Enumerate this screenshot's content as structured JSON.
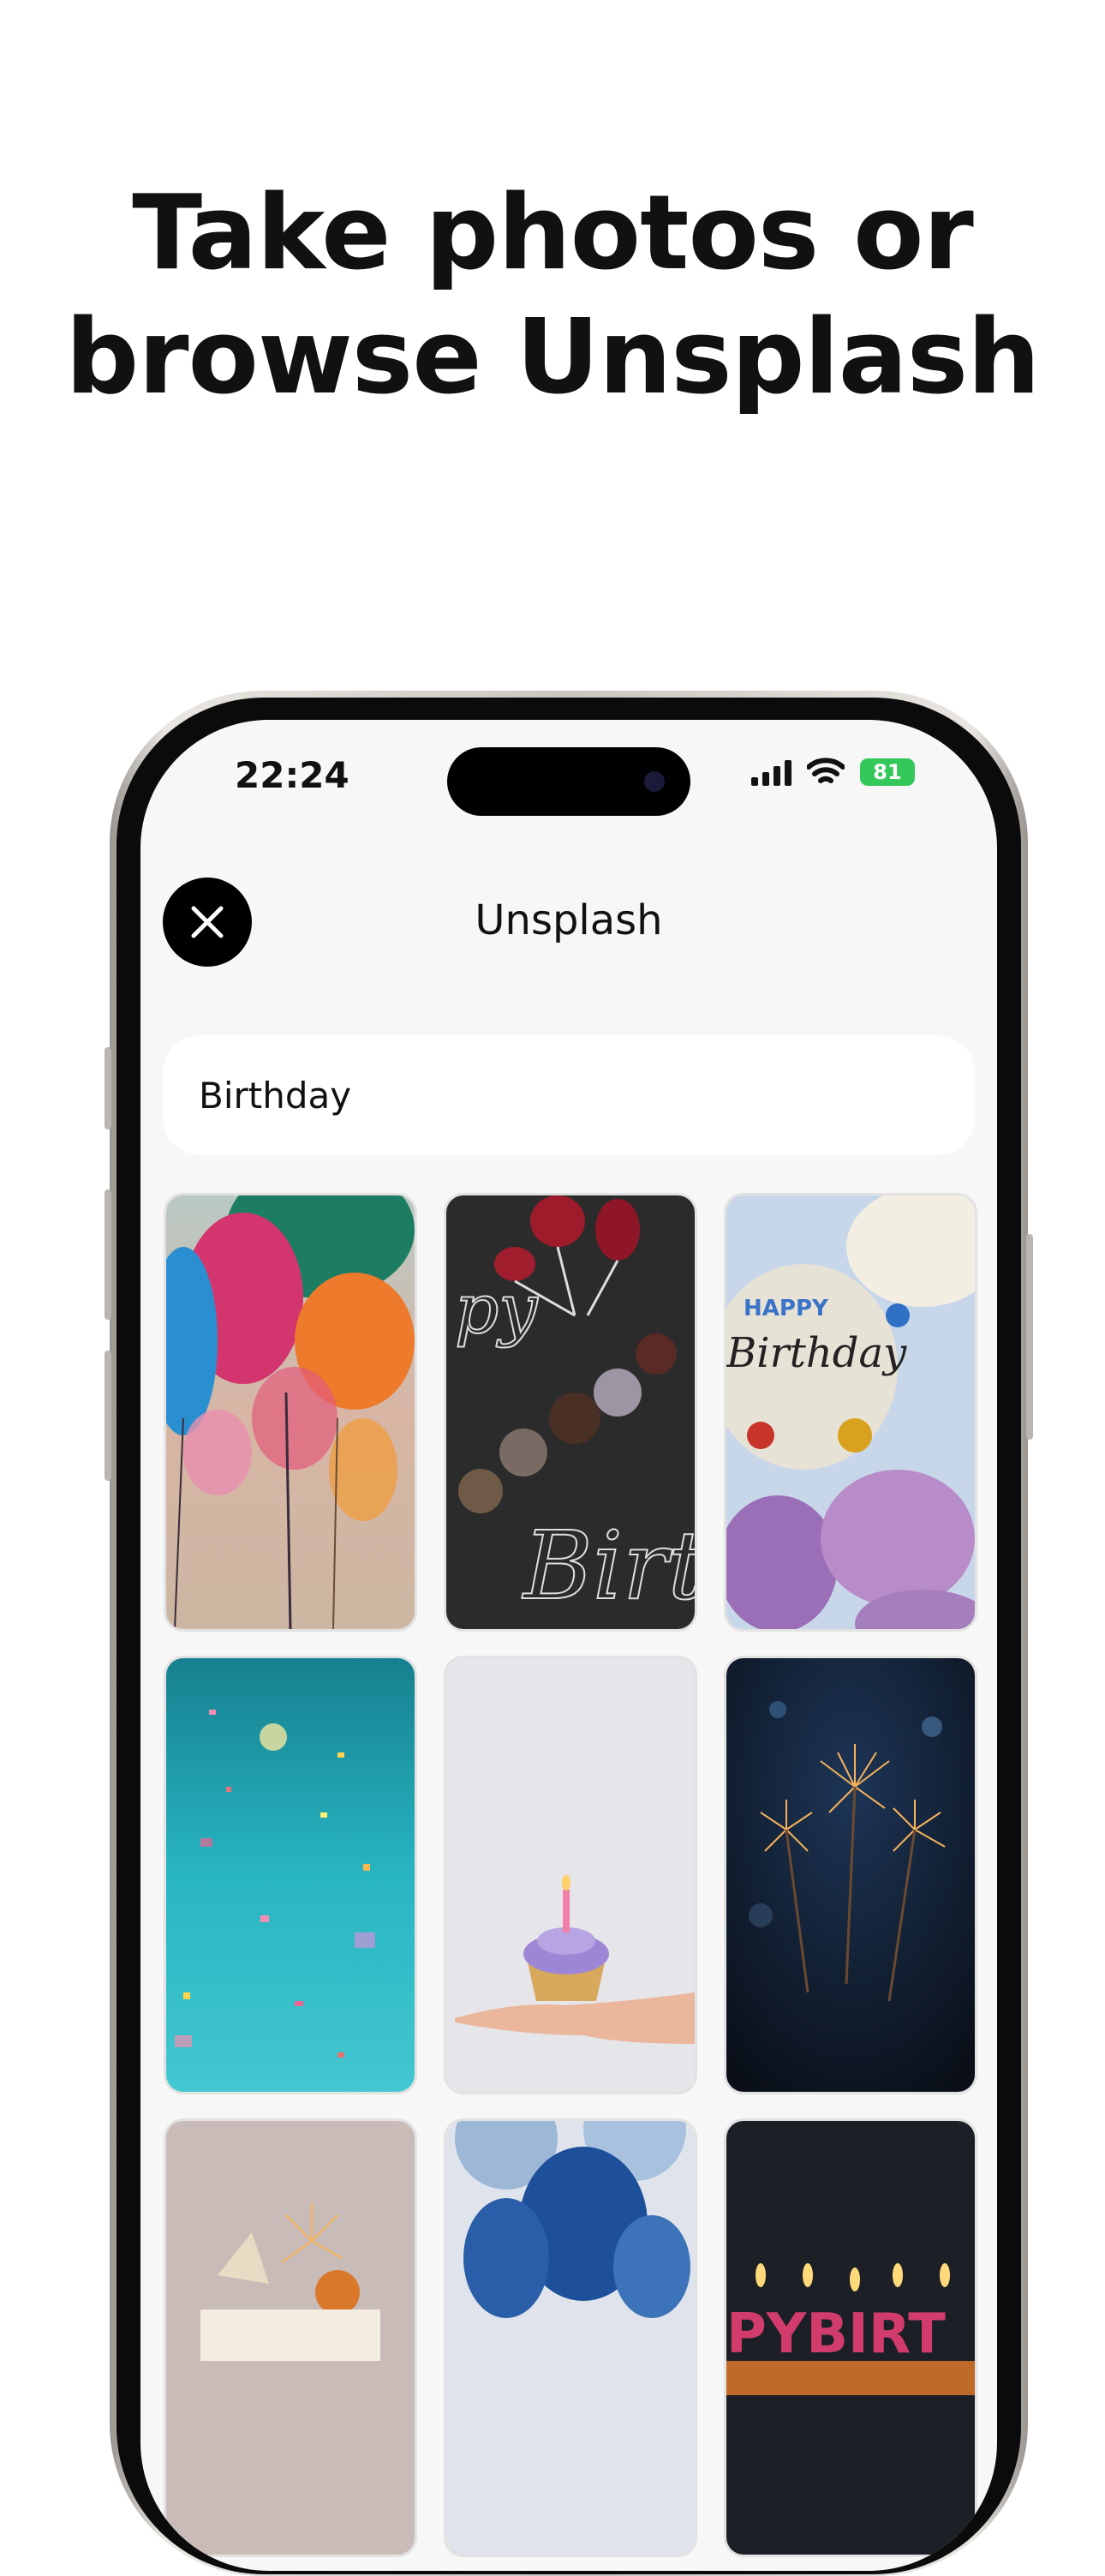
{
  "headline": {
    "line1": "Take photos or",
    "line2": "browse Unsplash"
  },
  "status_bar": {
    "time": "22:24",
    "battery": "81"
  },
  "nav": {
    "title": "Unsplash",
    "close_icon": "close-icon"
  },
  "search": {
    "value": "Birthday"
  },
  "photos": [
    {
      "subject": "colorful balloons"
    },
    {
      "subject": "chocolate balloons chalkboard"
    },
    {
      "subject": "happy birthday balloon"
    },
    {
      "subject": "confetti"
    },
    {
      "subject": "cupcake on hand"
    },
    {
      "subject": "sparklers"
    },
    {
      "subject": "cake with sparkler"
    },
    {
      "subject": "blue balloons"
    },
    {
      "subject": "birthday candles"
    }
  ],
  "photo_text": {
    "chalk_text_left": "py",
    "chalk_text_bottom": "Birth",
    "balloon_line1": "HAPPY",
    "balloon_line2": "Birthday",
    "candle_letters": "PYBIRT"
  }
}
